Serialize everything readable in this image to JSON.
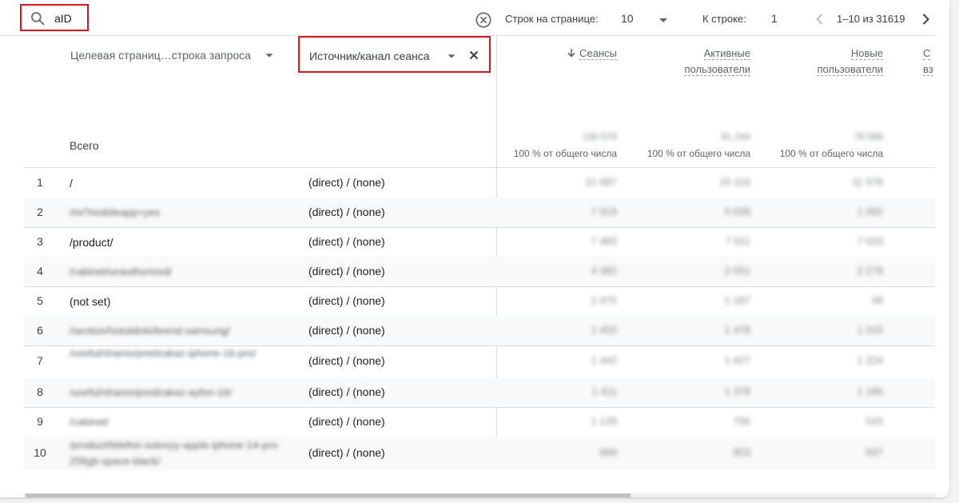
{
  "toolbar": {
    "search_value": "aID",
    "rows_per_page_label": "Строк на странице:",
    "rows_per_page_value": "10",
    "go_to_row_label": "К строке:",
    "go_to_row_value": "1",
    "pagination_range": "1–10 из 31619"
  },
  "header": {
    "dimension_primary": "Целевая страниц…строка запроса",
    "dimension_secondary": "Источник/канал сеанса",
    "metrics": [
      {
        "line1": "Сеансы",
        "line2": "",
        "sorted": true
      },
      {
        "line1": "Активные",
        "line2": "пользователи",
        "sorted": false
      },
      {
        "line1": "Новые",
        "line2": "пользователи",
        "sorted": false
      },
      {
        "line1": "С",
        "line2": "вз",
        "sorted": false
      }
    ],
    "total_label": "Всего",
    "totals": [
      "130 578",
      "91 244",
      "78 586"
    ],
    "total_pct": [
      "100 % от общего числа",
      "100 % от общего числа",
      "100 % от общего числа"
    ]
  },
  "rows": [
    {
      "index": "1",
      "page": "/",
      "blurred": false,
      "source": "(direct) / (none)",
      "values": [
        "21 687",
        "15 116",
        "11 576"
      ]
    },
    {
      "index": "2",
      "page": "/m/?mobileapp=yes",
      "blurred": true,
      "source": "(direct) / (none)",
      "values": [
        "7 919",
        "5 028",
        "1 092"
      ]
    },
    {
      "index": "3",
      "page": "/product/",
      "blurred": false,
      "source": "(direct) / (none)",
      "values": [
        "7 483",
        "7 011",
        "7 023"
      ]
    },
    {
      "index": "4",
      "page": "/cabinet/unauthorized/",
      "blurred": true,
      "source": "(direct) / (none)",
      "values": [
        "4 382",
        "2 051",
        "2 279"
      ]
    },
    {
      "index": "5",
      "page": "(not set)",
      "blurred": false,
      "source": "(direct) / (none)",
      "values": [
        "2 475",
        "1 187",
        "48"
      ]
    },
    {
      "index": "6",
      "page": "/section/hotoldinki/brend-samsung/",
      "blurred": true,
      "source": "(direct) / (none)",
      "values": [
        "1 455",
        "1 478",
        "1 315"
      ]
    },
    {
      "index": "7",
      "page": "/useful/shares/predzakaz-iphone-16-pro/",
      "blurred": true,
      "source": "(direct) / (none)",
      "values": [
        "1 442",
        "1 427",
        "1 224"
      ]
    },
    {
      "index": "8",
      "page": "/useful/shares/predzakaz-ayfon-16/",
      "blurred": true,
      "source": "(direct) / (none)",
      "values": [
        "1 411",
        "1 378",
        "1 186"
      ]
    },
    {
      "index": "9",
      "page": "/cabinet/",
      "blurred": true,
      "source": "(direct) / (none)",
      "values": [
        "1 129",
        "756",
        "515"
      ]
    },
    {
      "index": "10",
      "page": "/product/telefon-sotovyy-apple-iphone-14-pro-256gb-space-black/",
      "blurred": true,
      "source": "(direct) / (none)",
      "values": [
        "999",
        "803",
        "597"
      ]
    }
  ]
}
